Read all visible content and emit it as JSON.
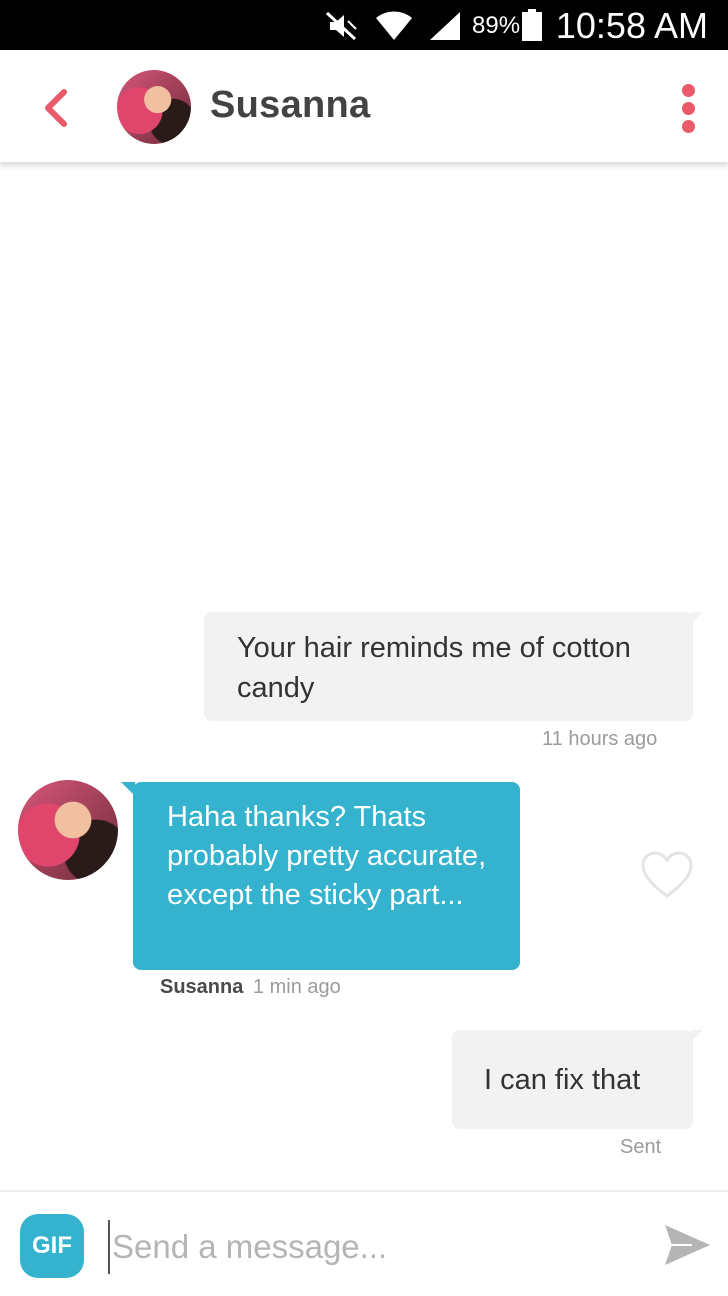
{
  "status_bar": {
    "time": "10:58 AM",
    "battery_percent": "89%",
    "icons": [
      "mute-icon",
      "wifi-icon",
      "signal-icon",
      "battery-icon"
    ]
  },
  "header": {
    "name": "Susanna",
    "back_icon": "chevron-left-icon",
    "menu_icon": "vertical-dots-icon",
    "accent_color": "#ea5a6a"
  },
  "messages": [
    {
      "direction": "sent",
      "text": "Your hair reminds me of cotton candy",
      "meta": "11 hours ago"
    },
    {
      "direction": "received",
      "text": "Haha thanks? Thats probably pretty accurate, except the sticky part...",
      "sender": "Susanna",
      "meta": "1 min ago",
      "bubble_color": "#35b3ce"
    },
    {
      "direction": "sent",
      "text": "I can fix that",
      "meta": "Sent"
    }
  ],
  "composer": {
    "gif_label": "GIF",
    "placeholder": "Send a message...",
    "send_icon": "send-icon"
  }
}
